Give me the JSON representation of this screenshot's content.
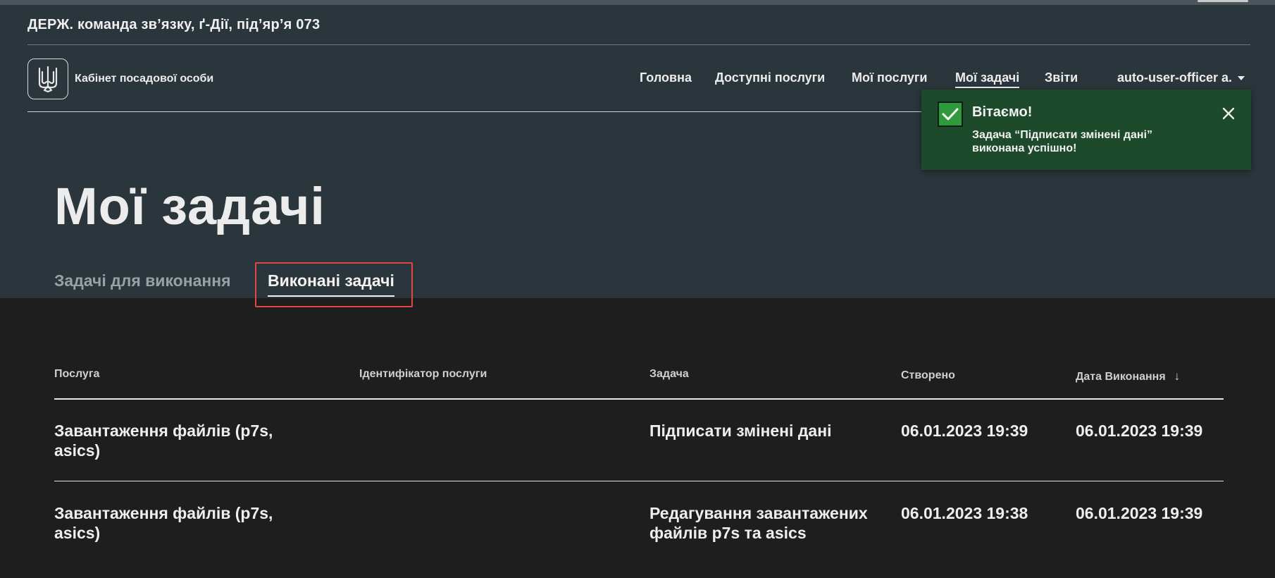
{
  "header": {
    "org_name": "ДЕРЖ. команда зв’язку, ґ-Дії, під’яр’я 073",
    "cabinet_title": "Кабінет посадової особи"
  },
  "nav": {
    "items": [
      {
        "label": "Головна"
      },
      {
        "label": "Доступні послуги"
      },
      {
        "label": "Мої послуги"
      },
      {
        "label": "Мої задачі",
        "active": true
      },
      {
        "label": "Звіти"
      }
    ],
    "user": "auto-user-officer a."
  },
  "toast": {
    "title": "Вітаємо!",
    "message": "Задача “Підписати змінені дані” виконана успішно!"
  },
  "page": {
    "title": "Мої задачі",
    "tabs": [
      {
        "label": "Задачі для виконання",
        "active": false
      },
      {
        "label": "Виконані задачі",
        "active": true
      }
    ]
  },
  "table": {
    "columns": [
      "Послуга",
      "Ідентифікатор послуги",
      "Задача",
      "Створено",
      "Дата Виконання"
    ],
    "sort_icon": "arrow-down-icon",
    "rows": [
      {
        "service": "Завантаження файлів (p7s, asics)",
        "service_id": "",
        "task": "Підписати змінені дані",
        "created": "06.01.2023 19:39",
        "completed": "06.01.2023 19:39"
      },
      {
        "service": "Завантаження файлів (p7s, asics)",
        "service_id": "",
        "task": "Редагування завантажених файлів p7s та asics",
        "created": "06.01.2023 19:38",
        "completed": "06.01.2023 19:39"
      }
    ]
  },
  "colors": {
    "header_bg": "#2b353c",
    "body_bg": "#1e1e1f",
    "toast_bg": "#1c4a2a",
    "highlight": "#e04848"
  }
}
